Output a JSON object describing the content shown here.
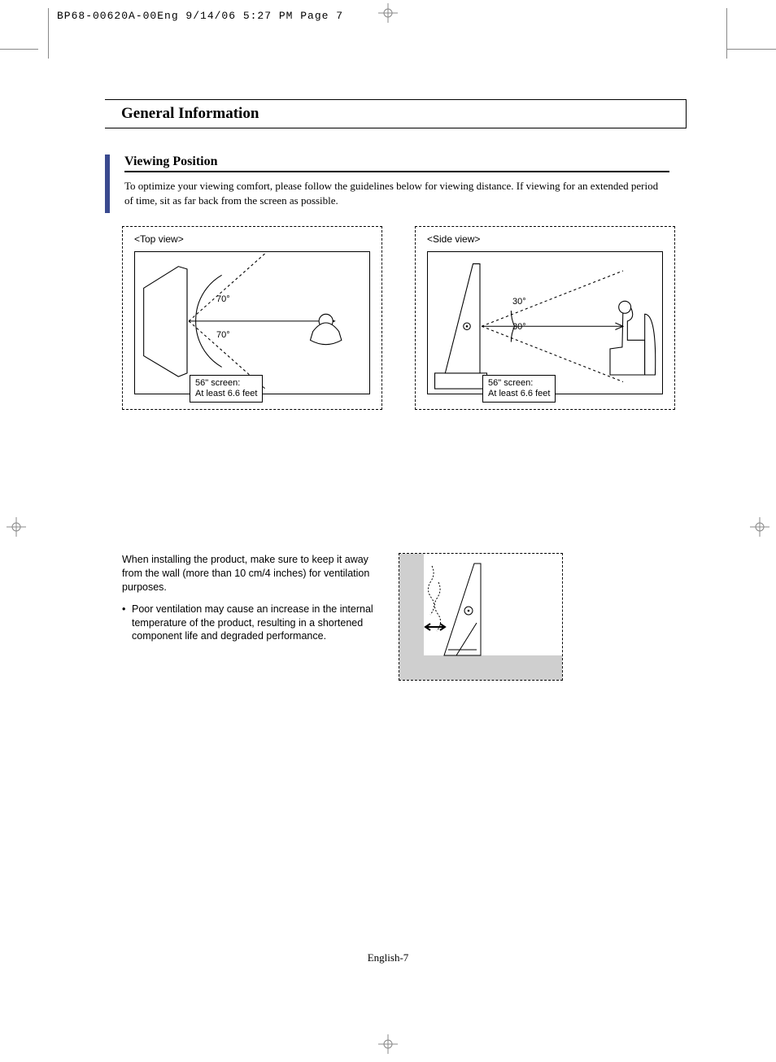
{
  "header": {
    "slug": "BP68-00620A-00Eng  9/14/06  5:27 PM  Page 7"
  },
  "title": "General Information",
  "section": {
    "heading": "Viewing Position",
    "body": "To optimize your viewing comfort, please follow the guidelines below for viewing distance. If viewing for an extended period of time, sit as far back from the screen as possible."
  },
  "diagrams": {
    "top_view": {
      "label": "<Top view>",
      "angle_top": "70°",
      "angle_bottom": "70°",
      "distance_line1": "56\" screen:",
      "distance_line2": "At least 6.6 feet"
    },
    "side_view": {
      "label": "<Side view>",
      "angle_top": "30°",
      "angle_bottom": "30°",
      "distance_line1": "56\" screen:",
      "distance_line2": "At least 6.6 feet"
    }
  },
  "install": {
    "para": "When installing the product, make sure to keep it away from the wall (more than 10 cm/4 inches) for ventilation purposes.",
    "bullet": "Poor ventilation may cause an increase in the internal temperature of the product, resulting in a shortened component life and degraded performance."
  },
  "footer": "English-7"
}
